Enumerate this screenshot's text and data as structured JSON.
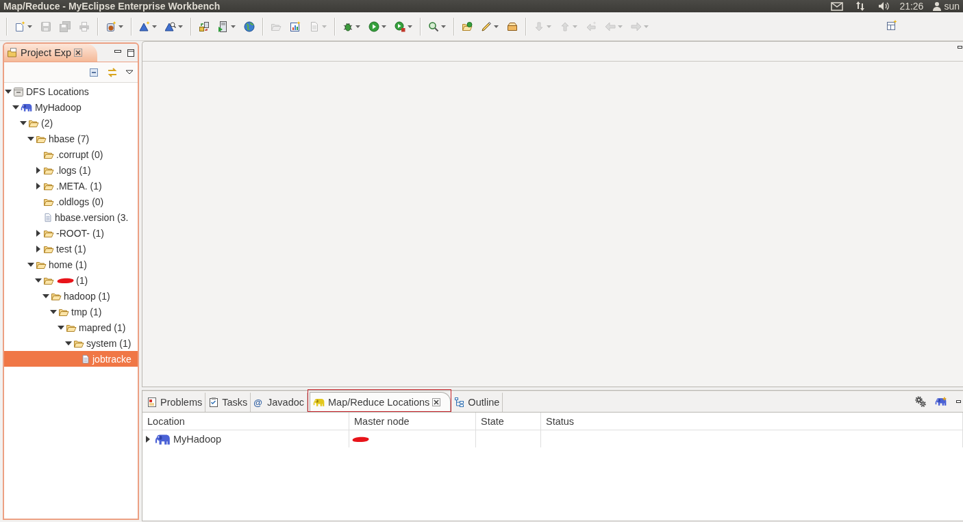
{
  "top_bar": {
    "title": "Map/Reduce - MyEclipse Enterprise Workbench",
    "clock": "21:26",
    "user": "sun"
  },
  "toolbar": {
    "groups": [
      [
        {
          "disabled": false,
          "dropdown": true
        },
        {
          "disabled": true,
          "dropdown": false
        },
        {
          "disabled": true,
          "dropdown": false
        },
        {
          "disabled": true,
          "dropdown": false
        }
      ],
      [
        {
          "disabled": false,
          "dropdown": true
        }
      ],
      [
        {
          "disabled": false,
          "dropdown": true
        },
        {
          "disabled": false,
          "dropdown": true
        }
      ],
      [
        {
          "disabled": false,
          "dropdown": false
        },
        {
          "disabled": false,
          "dropdown": true
        },
        {
          "disabled": false,
          "dropdown": false
        }
      ],
      [
        {
          "disabled": true,
          "dropdown": false
        },
        {
          "disabled": false,
          "dropdown": false
        },
        {
          "disabled": true,
          "dropdown": true
        }
      ],
      [
        {
          "disabled": false,
          "dropdown": true
        },
        {
          "disabled": false,
          "dropdown": true
        },
        {
          "disabled": false,
          "dropdown": true
        }
      ],
      [
        {
          "disabled": false,
          "dropdown": true
        }
      ],
      [
        {
          "disabled": false,
          "dropdown": false
        },
        {
          "disabled": false,
          "dropdown": true
        },
        {
          "disabled": false,
          "dropdown": false
        }
      ],
      [
        {
          "disabled": true,
          "dropdown": true
        },
        {
          "disabled": true,
          "dropdown": true
        },
        {
          "disabled": true,
          "dropdown": false
        },
        {
          "disabled": true,
          "dropdown": true
        },
        {
          "disabled": true,
          "dropdown": true
        }
      ]
    ]
  },
  "project_explorer": {
    "tab": {
      "label": "Project Exp",
      "selected": true
    },
    "tree": [
      {
        "label": "DFS Locations",
        "kind": "dfs",
        "expandable": true,
        "expanded": true,
        "selected": false,
        "redacted": false,
        "children": [
          {
            "label": "MyHadoop",
            "kind": "location",
            "expandable": true,
            "expanded": true,
            "selected": false,
            "redacted": false,
            "children": [
              {
                "label": "(2)",
                "kind": "folder",
                "expandable": true,
                "expanded": true,
                "selected": false,
                "redacted": false,
                "children": [
                  {
                    "label": "hbase (7)",
                    "kind": "folder",
                    "expandable": true,
                    "expanded": true,
                    "selected": false,
                    "redacted": false,
                    "children": [
                      {
                        "label": ".corrupt (0)",
                        "kind": "folder",
                        "expandable": false,
                        "expanded": false,
                        "selected": false,
                        "redacted": false
                      },
                      {
                        "label": ".logs (1)",
                        "kind": "folder",
                        "expandable": true,
                        "expanded": false,
                        "selected": false,
                        "redacted": false
                      },
                      {
                        "label": ".META. (1)",
                        "kind": "folder",
                        "expandable": true,
                        "expanded": false,
                        "selected": false,
                        "redacted": false
                      },
                      {
                        "label": ".oldlogs (0)",
                        "kind": "folder",
                        "expandable": false,
                        "expanded": false,
                        "selected": false,
                        "redacted": false
                      },
                      {
                        "label": "hbase.version (3.",
                        "kind": "file",
                        "expandable": false,
                        "expanded": false,
                        "selected": false,
                        "redacted": false
                      },
                      {
                        "label": "-ROOT- (1)",
                        "kind": "folder",
                        "expandable": true,
                        "expanded": false,
                        "selected": false,
                        "redacted": false
                      },
                      {
                        "label": "test (1)",
                        "kind": "folder",
                        "expandable": true,
                        "expanded": false,
                        "selected": false,
                        "redacted": false
                      }
                    ]
                  },
                  {
                    "label": "home (1)",
                    "kind": "folder",
                    "expandable": true,
                    "expanded": true,
                    "selected": false,
                    "redacted": false,
                    "children": [
                      {
                        "label": "(1)",
                        "kind": "folder",
                        "expandable": true,
                        "expanded": true,
                        "selected": false,
                        "redacted": true,
                        "children": [
                          {
                            "label": "hadoop (1)",
                            "kind": "folder",
                            "expandable": true,
                            "expanded": true,
                            "selected": false,
                            "redacted": false,
                            "children": [
                              {
                                "label": "tmp (1)",
                                "kind": "folder",
                                "expandable": true,
                                "expanded": true,
                                "selected": false,
                                "redacted": false,
                                "children": [
                                  {
                                    "label": "mapred (1)",
                                    "kind": "folder",
                                    "expandable": true,
                                    "expanded": true,
                                    "selected": false,
                                    "redacted": false,
                                    "children": [
                                      {
                                        "label": "system (1)",
                                        "kind": "folder",
                                        "expandable": true,
                                        "expanded": true,
                                        "selected": false,
                                        "redacted": false,
                                        "children": [
                                          {
                                            "label": "jobtracke",
                                            "kind": "file",
                                            "expandable": false,
                                            "expanded": false,
                                            "selected": true,
                                            "redacted": false
                                          }
                                        ]
                                      }
                                    ]
                                  }
                                ]
                              }
                            ]
                          }
                        ]
                      }
                    ]
                  }
                ]
              }
            ]
          }
        ]
      }
    ]
  },
  "bottom_panel": {
    "tabs": [
      {
        "label": "Problems",
        "selected": false,
        "highlighted": false
      },
      {
        "label": "Tasks",
        "selected": false,
        "highlighted": false
      },
      {
        "label": "Javadoc",
        "glyph": "@",
        "selected": false,
        "highlighted": false
      },
      {
        "label": "Map/Reduce Locations",
        "selected": true,
        "highlighted": true
      },
      {
        "label": "Outline",
        "selected": false,
        "highlighted": false
      }
    ],
    "table": {
      "columns": [
        "Location",
        "Master node",
        "State",
        "Status"
      ],
      "rows": [
        {
          "expanded": false,
          "location": "MyHadoop",
          "master_node_redacted": true
        }
      ]
    }
  }
}
